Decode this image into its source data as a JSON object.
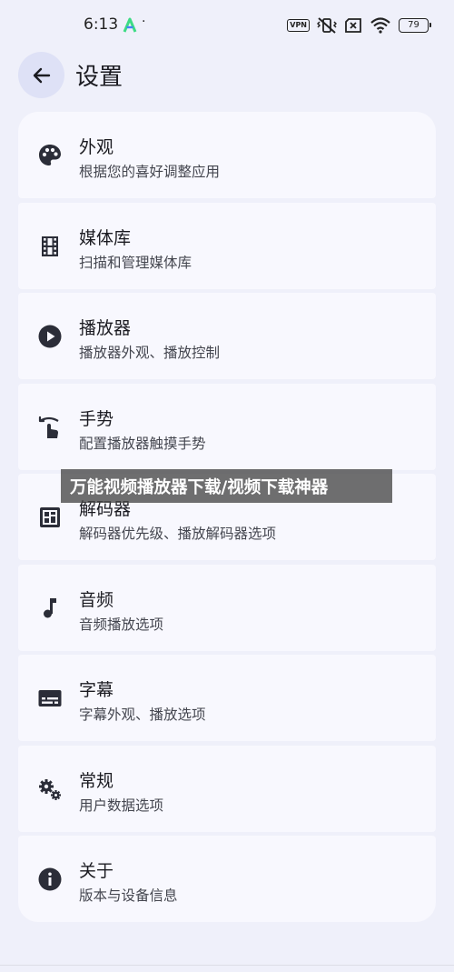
{
  "status_bar": {
    "time": "6:13",
    "dot": "·",
    "vpn_label": "VPN",
    "battery_level": "79"
  },
  "header": {
    "title": "设置",
    "back_icon": "arrow-back-icon"
  },
  "settings": {
    "items": [
      {
        "icon": "palette-icon",
        "title": "外观",
        "subtitle": "根据您的喜好调整应用"
      },
      {
        "icon": "film-strip-icon",
        "title": "媒体库",
        "subtitle": "扫描和管理媒体库"
      },
      {
        "icon": "play-circle-icon",
        "title": "播放器",
        "subtitle": "播放器外观、播放控制"
      },
      {
        "icon": "swipe-gesture-icon",
        "title": "手势",
        "subtitle": "配置播放器触摸手势"
      },
      {
        "icon": "chip-icon",
        "title": "解码器",
        "subtitle": "解码器优先级、播放解码器选项"
      },
      {
        "icon": "music-note-icon",
        "title": "音频",
        "subtitle": "音频播放选项"
      },
      {
        "icon": "subtitles-icon",
        "title": "字幕",
        "subtitle": "字幕外观、播放选项"
      },
      {
        "icon": "gears-icon",
        "title": "常规",
        "subtitle": "用户数据选项"
      },
      {
        "icon": "info-icon",
        "title": "关于",
        "subtitle": "版本与设备信息"
      }
    ]
  },
  "watermark": {
    "text": "万能视频播放器下载/视频下载神器"
  },
  "colors": {
    "background": "#eff0fa",
    "card": "#f8f8fe",
    "back_button_bg": "#dee1f6",
    "icon": "#2b2d38",
    "app_icon_green": "#3ddc84"
  }
}
